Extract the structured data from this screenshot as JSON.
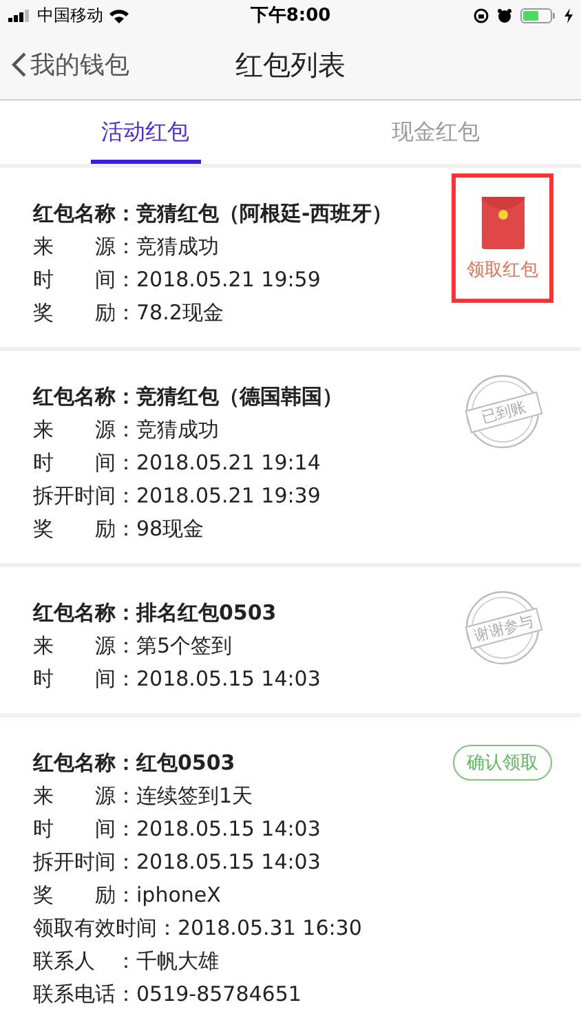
{
  "status_bar": {
    "carrier": "中国移动",
    "time": "下午8:00"
  },
  "nav": {
    "back": "我的钱包",
    "title": "红包列表"
  },
  "tabs": [
    {
      "label": "活动红包",
      "selected": true
    },
    {
      "label": "现金红包",
      "selected": false
    }
  ],
  "packets": [
    {
      "fields": [
        {
          "label": "红包名称：",
          "value": "竞猜红包（阿根廷-西班牙）"
        },
        {
          "label": "来　　源：",
          "value": "竞猜成功"
        },
        {
          "label": "时　　间：",
          "value": "2018.05.21 19:59"
        },
        {
          "label": "奖　　励：",
          "value": "78.2现金"
        }
      ],
      "action": {
        "kind": "envelope",
        "label": "领取红包",
        "highlighted": true
      }
    },
    {
      "fields": [
        {
          "label": "红包名称：",
          "value": "竞猜红包（德国韩国）"
        },
        {
          "label": "来　　源：",
          "value": "竞猜成功"
        },
        {
          "label": "时　　间：",
          "value": "2018.05.21 19:14"
        },
        {
          "label": "拆开时间：",
          "value": "2018.05.21 19:39"
        },
        {
          "label": "奖　　励：",
          "value": "98现金"
        }
      ],
      "action": {
        "kind": "stamp",
        "label": "已到账"
      }
    },
    {
      "fields": [
        {
          "label": "红包名称：",
          "value": "排名红包0503"
        },
        {
          "label": "来　　源：",
          "value": "第5个签到"
        },
        {
          "label": "时　　间：",
          "value": "2018.05.15 14:03"
        }
      ],
      "action": {
        "kind": "stamp",
        "label": "谢谢参与"
      }
    },
    {
      "fields": [
        {
          "label": "红包名称：",
          "value": "红包0503"
        },
        {
          "label": "来　　源：",
          "value": "连续签到1天"
        },
        {
          "label": "时　　间：",
          "value": "2018.05.15 14:03"
        },
        {
          "label": "拆开时间：",
          "value": "2018.05.15 14:03"
        },
        {
          "label": "奖　　励：",
          "value": "iphoneX"
        },
        {
          "label": "领取有效时间：",
          "value": "2018.05.31 16:30"
        },
        {
          "label": "联系人　：",
          "value": "千帆大雄"
        },
        {
          "label": "联系电话：",
          "value": "0519-85784651"
        }
      ],
      "action": {
        "kind": "button",
        "label": "确认领取"
      }
    }
  ]
}
